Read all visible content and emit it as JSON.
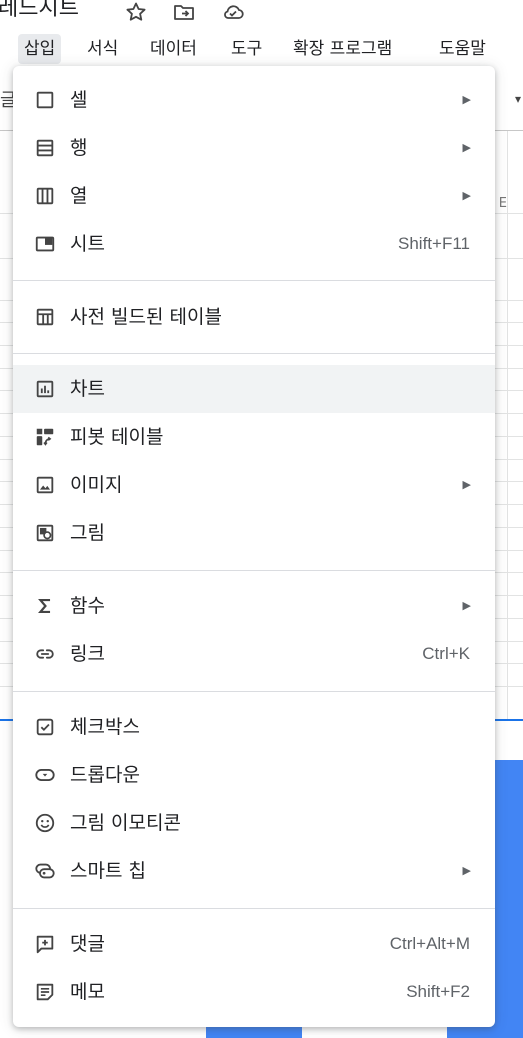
{
  "header": {
    "doc_title_fragment": "레드시트",
    "menus": [
      "삽입",
      "서식",
      "데이터",
      "도구",
      "확장 프로그램",
      "도움말"
    ]
  },
  "toolbar": {
    "left_fragment": "글",
    "right_fragment": "▾",
    "column_fragment": "E"
  },
  "insert_menu": {
    "items": [
      {
        "label": "셀",
        "icon": "cell-icon",
        "shortcut": "",
        "submenu": true
      },
      {
        "label": "행",
        "icon": "rows-icon",
        "shortcut": "",
        "submenu": true
      },
      {
        "label": "열",
        "icon": "columns-icon",
        "shortcut": "",
        "submenu": true
      },
      {
        "label": "시트",
        "icon": "sheet-icon",
        "shortcut": "Shift+F11",
        "submenu": false
      },
      {
        "label": "사전 빌드된 테이블",
        "icon": "table-icon",
        "shortcut": "",
        "submenu": false
      },
      {
        "label": "차트",
        "icon": "chart-icon",
        "shortcut": "",
        "submenu": false
      },
      {
        "label": "피봇 테이블",
        "icon": "pivot-table-icon",
        "shortcut": "",
        "submenu": false
      },
      {
        "label": "이미지",
        "icon": "image-icon",
        "shortcut": "",
        "submenu": true
      },
      {
        "label": "그림",
        "icon": "drawing-icon",
        "shortcut": "",
        "submenu": false
      },
      {
        "label": "함수",
        "icon": "sigma-icon",
        "shortcut": "",
        "submenu": true
      },
      {
        "label": "링크",
        "icon": "link-icon",
        "shortcut": "Ctrl+K",
        "submenu": false
      },
      {
        "label": "체크박스",
        "icon": "checkbox-icon",
        "shortcut": "",
        "submenu": false
      },
      {
        "label": "드롭다운",
        "icon": "dropdown-icon",
        "shortcut": "",
        "submenu": false
      },
      {
        "label": "그림 이모티콘",
        "icon": "emoji-icon",
        "shortcut": "",
        "submenu": false
      },
      {
        "label": "스마트 칩",
        "icon": "smart-chip-icon",
        "shortcut": "",
        "submenu": true
      },
      {
        "label": "댓글",
        "icon": "comment-icon",
        "shortcut": "Ctrl+Alt+M",
        "submenu": false
      },
      {
        "label": "메모",
        "icon": "note-icon",
        "shortcut": "Shift+F2",
        "submenu": false
      }
    ],
    "submenu_arrow": "▶",
    "highlighted": "차트"
  },
  "colors": {
    "accent": "#1a73e8",
    "chart_bar": "#4285f4",
    "hover": "#f1f3f4",
    "active_menu": "#e8eaed"
  }
}
